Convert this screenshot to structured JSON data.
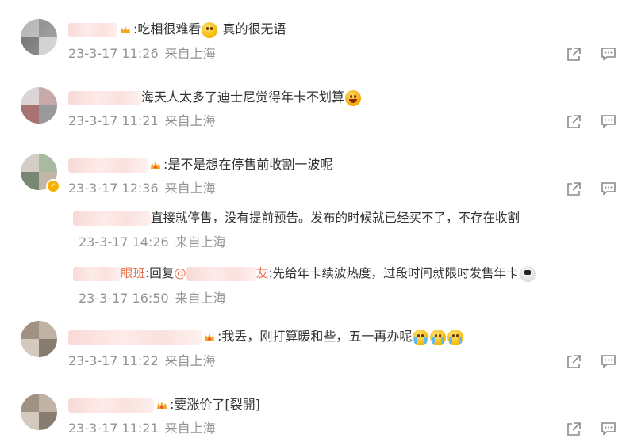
{
  "comments": [
    {
      "text": ":吃相很难看",
      "text2": " 真的很无语",
      "time": "23-3-17 11:26",
      "location": "来自上海"
    },
    {
      "text": "海天人太多了迪士尼觉得年卡不划算",
      "time": "23-3-17 11:21",
      "location": "来自上海"
    },
    {
      "text": ":是不是想在停售前收割一波呢",
      "time": "23-3-17 12:36",
      "location": "来自上海",
      "replies": [
        {
          "text": "直接就停售，没有提前预告。发布的时候就已经买不了，不存在收割",
          "time": "23-3-17 14:26",
          "location": "来自上海"
        },
        {
          "name_fragment": "眼班",
          "reply_word": ":回复",
          "at": "@",
          "name_tail": "友",
          "text": ":先给年卡续波热度，过段时间就限时发售年卡",
          "time": "23-3-17 16:50",
          "location": "来自上海"
        }
      ]
    },
    {
      "text": ":我丢，刚打算暖和些，五一再办呢",
      "time": "23-3-17 11:22",
      "location": "来自上海"
    },
    {
      "text": ":要涨价了[裂開]",
      "time": "23-3-17 11:21",
      "location": "来自上海"
    }
  ],
  "icons": {
    "share": "share-icon",
    "comment": "comment-icon",
    "crown": "crown-icon",
    "verified": "verified-badge-icon"
  },
  "colors": {
    "meta": "#939393",
    "link": "#eb7350",
    "icon": "#8a8a8a"
  }
}
